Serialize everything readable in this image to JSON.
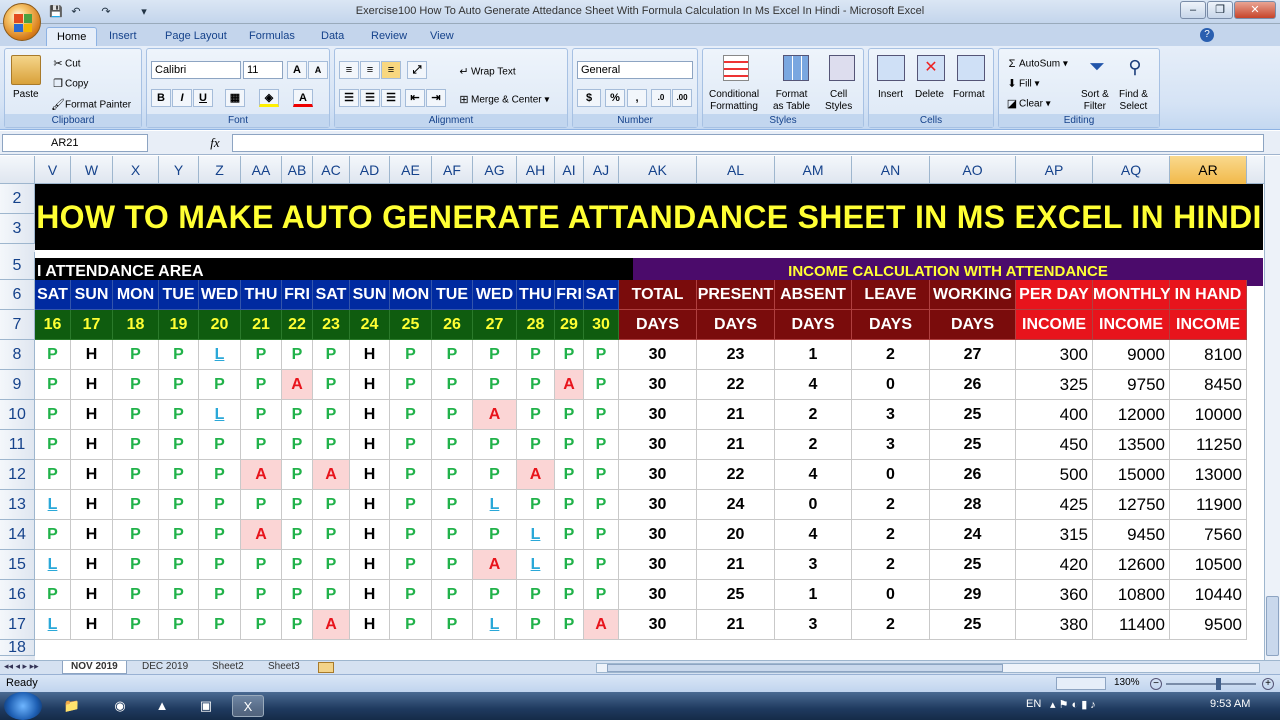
{
  "window": {
    "title": "Exercise100  How To Auto Generate Attedance Sheet With Formula Calculation In Ms Excel In Hindi - Microsoft Excel"
  },
  "tabs": [
    "Home",
    "Insert",
    "Page Layout",
    "Formulas",
    "Data",
    "Review",
    "View"
  ],
  "ribbon": {
    "clipboard": {
      "label": "Clipboard",
      "paste": "Paste",
      "cut": "Cut",
      "copy": "Copy",
      "painter": "Format Painter"
    },
    "font": {
      "label": "Font",
      "name": "Calibri",
      "size": "11"
    },
    "alignment": {
      "label": "Alignment",
      "wrap": "Wrap Text",
      "merge": "Merge & Center"
    },
    "number": {
      "label": "Number",
      "format": "General"
    },
    "styles": {
      "label": "Styles",
      "cond1": "Conditional",
      "cond2": "Formatting",
      "fmt1": "Format",
      "fmt2": "as Table",
      "cell1": "Cell",
      "cell2": "Styles"
    },
    "cells": {
      "label": "Cells",
      "insert": "Insert",
      "delete": "Delete",
      "format": "Format"
    },
    "editing": {
      "label": "Editing",
      "autosum": "AutoSum",
      "fill": "Fill",
      "clear": "Clear",
      "sort1": "Sort &",
      "sort2": "Filter",
      "find1": "Find &",
      "find2": "Select"
    }
  },
  "namebox": "AR21",
  "fx": "fx",
  "columns": [
    "V",
    "W",
    "X",
    "Y",
    "Z",
    "AA",
    "AB",
    "AC",
    "AD",
    "AE",
    "AF",
    "AG",
    "AH",
    "AI",
    "AJ",
    "AK",
    "AL",
    "AM",
    "AN",
    "AO",
    "AP",
    "AQ",
    "AR"
  ],
  "rows": [
    "2",
    "3",
    "5",
    "6",
    "7",
    "8",
    "9",
    "10",
    "11",
    "12",
    "13",
    "14",
    "15",
    "16",
    "17",
    "18"
  ],
  "banner": "HOW TO MAKE AUTO GENERATE ATTANDANCE SHEET IN MS EXCEL IN HINDI",
  "attendance_area": "I ATTENDANCE AREA",
  "income_title": "INCOME CALCULATION WITH ATTENDANCE",
  "days": [
    "SAT",
    "SUN",
    "MON",
    "TUE",
    "WED",
    "THU",
    "FRI",
    "SAT",
    "SUN",
    "MON",
    "TUE",
    "WED",
    "THU",
    "FRI",
    "SAT"
  ],
  "dates": [
    "16",
    "17",
    "18",
    "19",
    "20",
    "21",
    "22",
    "23",
    "24",
    "25",
    "26",
    "27",
    "28",
    "29",
    "30"
  ],
  "summary_head1": [
    "TOTAL",
    "PRESENT",
    "ABSENT",
    "LEAVE",
    "WORKING",
    "PER DAY",
    "MONTHLY",
    "IN HAND"
  ],
  "summary_head2": [
    "DAYS",
    "DAYS",
    "DAYS",
    "DAYS",
    "DAYS",
    "INCOME",
    "INCOME",
    "INCOME"
  ],
  "attendance": [
    [
      "P",
      "H",
      "P",
      "P",
      "L",
      "P",
      "P",
      "P",
      "H",
      "P",
      "P",
      "P",
      "P",
      "P",
      "P"
    ],
    [
      "P",
      "H",
      "P",
      "P",
      "P",
      "P",
      "A",
      "P",
      "H",
      "P",
      "P",
      "P",
      "P",
      "A",
      "P"
    ],
    [
      "P",
      "H",
      "P",
      "P",
      "L",
      "P",
      "P",
      "P",
      "H",
      "P",
      "P",
      "A",
      "P",
      "P",
      "P"
    ],
    [
      "P",
      "H",
      "P",
      "P",
      "P",
      "P",
      "P",
      "P",
      "H",
      "P",
      "P",
      "P",
      "P",
      "P",
      "P"
    ],
    [
      "P",
      "H",
      "P",
      "P",
      "P",
      "A",
      "P",
      "A",
      "H",
      "P",
      "P",
      "P",
      "A",
      "P",
      "P"
    ],
    [
      "L",
      "H",
      "P",
      "P",
      "P",
      "P",
      "P",
      "P",
      "H",
      "P",
      "P",
      "L",
      "P",
      "P",
      "P"
    ],
    [
      "P",
      "H",
      "P",
      "P",
      "P",
      "A",
      "P",
      "P",
      "H",
      "P",
      "P",
      "P",
      "L",
      "P",
      "P"
    ],
    [
      "L",
      "H",
      "P",
      "P",
      "P",
      "P",
      "P",
      "P",
      "H",
      "P",
      "P",
      "A",
      "L",
      "P",
      "P"
    ],
    [
      "P",
      "H",
      "P",
      "P",
      "P",
      "P",
      "P",
      "P",
      "H",
      "P",
      "P",
      "P",
      "P",
      "P",
      "P"
    ],
    [
      "L",
      "H",
      "P",
      "P",
      "P",
      "P",
      "P",
      "A",
      "H",
      "P",
      "P",
      "L",
      "P",
      "P",
      "A"
    ]
  ],
  "summary": [
    [
      "30",
      "23",
      "1",
      "2",
      "27",
      "300",
      "9000",
      "8100"
    ],
    [
      "30",
      "22",
      "4",
      "0",
      "26",
      "325",
      "9750",
      "8450"
    ],
    [
      "30",
      "21",
      "2",
      "3",
      "25",
      "400",
      "12000",
      "10000"
    ],
    [
      "30",
      "21",
      "2",
      "3",
      "25",
      "450",
      "13500",
      "11250"
    ],
    [
      "30",
      "22",
      "4",
      "0",
      "26",
      "500",
      "15000",
      "13000"
    ],
    [
      "30",
      "24",
      "0",
      "2",
      "28",
      "425",
      "12750",
      "11900"
    ],
    [
      "30",
      "20",
      "4",
      "2",
      "24",
      "315",
      "9450",
      "7560"
    ],
    [
      "30",
      "21",
      "3",
      "2",
      "25",
      "420",
      "12600",
      "10500"
    ],
    [
      "30",
      "25",
      "1",
      "0",
      "29",
      "360",
      "10800",
      "10440"
    ],
    [
      "30",
      "21",
      "3",
      "2",
      "25",
      "380",
      "11400",
      "9500"
    ]
  ],
  "sheet_tabs": [
    "NOV 2019",
    "DEC 2019",
    "Sheet2",
    "Sheet3"
  ],
  "status": {
    "ready": "Ready",
    "zoom": "130%"
  },
  "tray": {
    "lang": "EN",
    "time": "9:53 AM"
  },
  "colors": {
    "banner_bg": "#000000",
    "banner_text": "#ffff33",
    "day_bg": "#002aa0",
    "date_bg": "#0f5c0f",
    "income_bg": "#4b0b6b",
    "summary_bg": "#7a0c0c",
    "income_red": "#e8141c",
    "present": "#21b24a",
    "leave": "#2aa8d8",
    "absent": "#e8141c"
  }
}
